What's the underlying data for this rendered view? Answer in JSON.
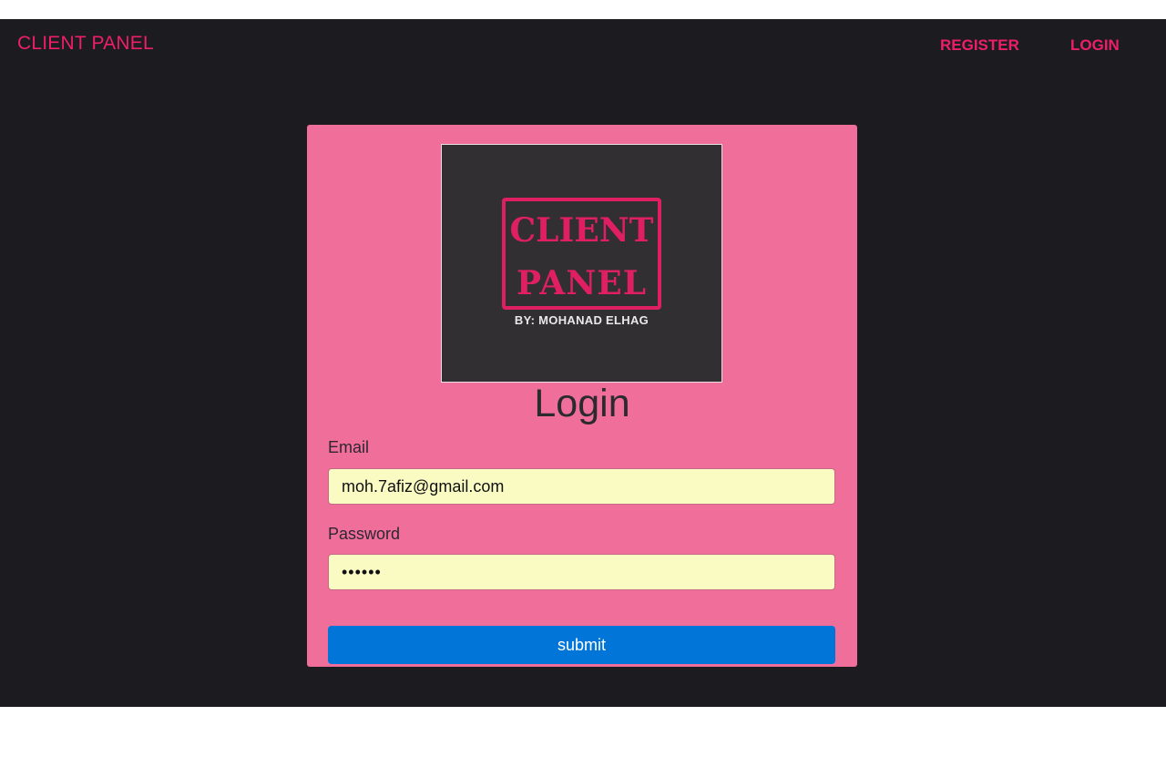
{
  "navbar": {
    "brand": "CLIENT PANEL",
    "links": [
      {
        "label": "REGISTER"
      },
      {
        "label": "LOGIN"
      }
    ]
  },
  "logo": {
    "line1": "CLIENT",
    "line2": "PANEL",
    "byline": "BY: MOHANAD ELHAG"
  },
  "form": {
    "title": "Login",
    "email_label": "Email",
    "email_value": "moh.7afiz@gmail.com",
    "password_label": "Password",
    "password_value": "••••••",
    "submit_label": "submit"
  },
  "colors": {
    "accent": "#ee1f66",
    "background": "#1c1b1f",
    "card": "#f06f9a",
    "input": "#fafbc3",
    "button": "#0275d8"
  }
}
